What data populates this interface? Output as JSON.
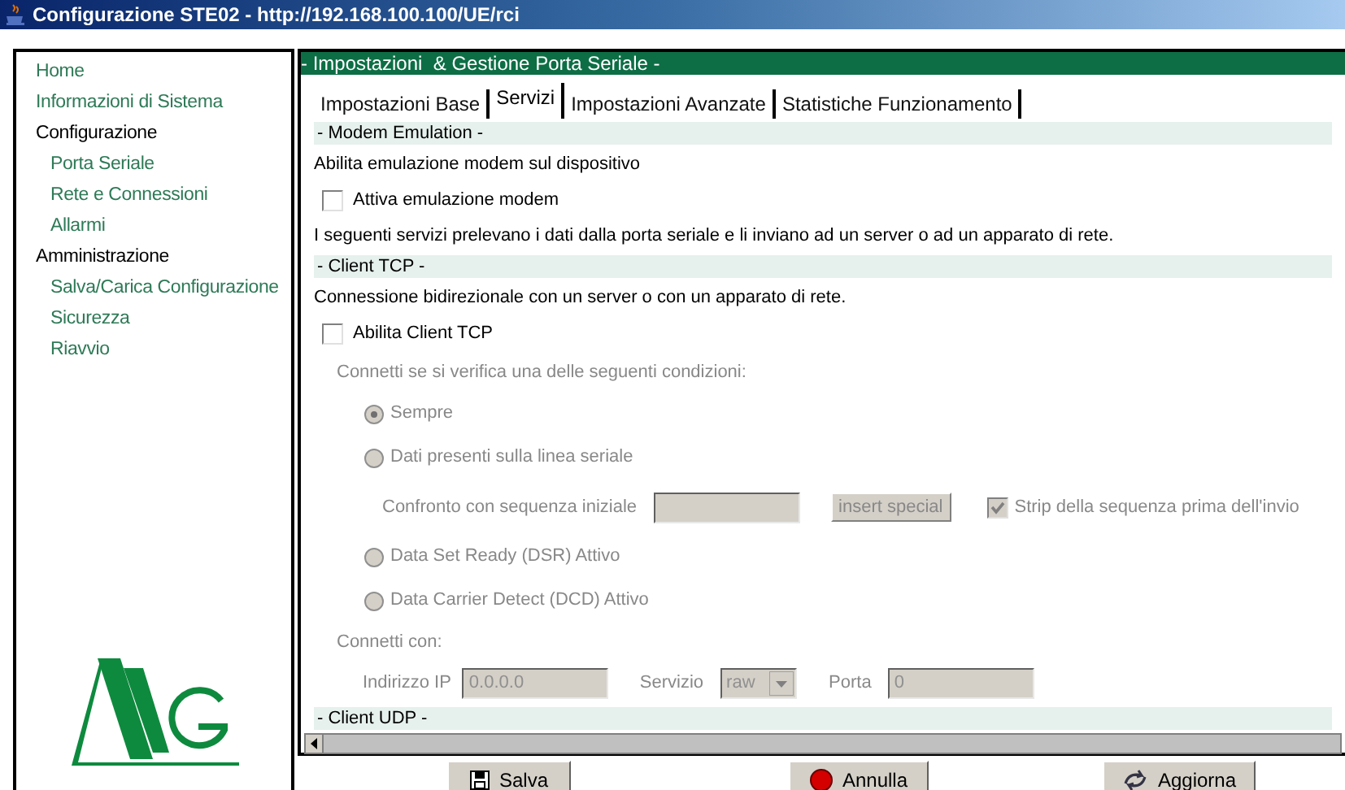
{
  "window": {
    "title": "Configurazione STE02 - http://192.168.100.100/UE/rci"
  },
  "sidebar": {
    "items": [
      {
        "label": "Home"
      },
      {
        "label": "Informazioni di Sistema"
      },
      {
        "label": "Configurazione",
        "children": [
          {
            "label": "Porta Seriale"
          },
          {
            "label": "Rete e Connessioni"
          },
          {
            "label": "Allarmi"
          }
        ]
      },
      {
        "label": "Amministrazione",
        "children": [
          {
            "label": "Salva/Carica Configurazione"
          },
          {
            "label": "Sicurezza"
          },
          {
            "label": "Riavvio"
          }
        ]
      }
    ]
  },
  "panel": {
    "title": "- Impostazioni  & Gestione Porta Seriale -",
    "tabs": [
      {
        "label": "Impostazioni Base",
        "selected": false
      },
      {
        "label": "Servizi",
        "selected": true
      },
      {
        "label": "Impostazioni Avanzate",
        "selected": false
      },
      {
        "label": "Statistiche Funzionamento",
        "selected": false
      }
    ],
    "content": [
      {
        "kind": "header",
        "text": "- Modem Emulation -"
      },
      {
        "kind": "text",
        "text": "Abilita emulazione modem sul dispositivo"
      },
      {
        "kind": "checkbox",
        "label": "Attiva emulazione modem",
        "checked": false,
        "disabled": false
      },
      {
        "kind": "text",
        "text": "I seguenti servizi prelevano i dati dalla porta seriale e li inviano ad un server o ad un apparato di rete."
      },
      {
        "kind": "header",
        "text": "- Client TCP -"
      },
      {
        "kind": "text",
        "text": "Connessione bidirezionale con un server o con un apparato di rete."
      },
      {
        "kind": "checkbox",
        "label": "Abilita Client TCP",
        "checked": false,
        "disabled": false
      },
      {
        "kind": "note",
        "text": "Connetti se si verifica una delle seguenti condizioni:",
        "disabled": true
      },
      {
        "kind": "radio",
        "label": "Sempre",
        "selected": true,
        "disabled": true
      },
      {
        "kind": "radio",
        "label": "Dati presenti sulla linea seriale",
        "selected": false,
        "disabled": true
      },
      {
        "kind": "sequence",
        "label": "Confronto con sequenza iniziale",
        "button": "insert special",
        "check_label": "Strip della sequenza prima dell'invio",
        "checked": true,
        "disabled": true
      },
      {
        "kind": "radio",
        "label": "Data Set Ready (DSR) Attivo",
        "selected": false,
        "disabled": true
      },
      {
        "kind": "radio",
        "label": "Data Carrier Detect (DCD) Attivo",
        "selected": false,
        "disabled": true
      },
      {
        "kind": "note",
        "text": "Connetti con:",
        "disabled": true
      },
      {
        "kind": "connection",
        "ip_label": "Indirizzo IP",
        "ip": "0.0.0.0",
        "service_label": "Servizio",
        "service": "raw",
        "port_label": "Porta",
        "port": "0",
        "disabled": true
      },
      {
        "kind": "header",
        "text": "- Client UDP -"
      }
    ]
  },
  "buttons": [
    {
      "label": "Salva",
      "kind": "save"
    },
    {
      "label": "Annulla",
      "kind": "cancel"
    },
    {
      "label": "Aggiorna",
      "kind": "refresh"
    }
  ]
}
